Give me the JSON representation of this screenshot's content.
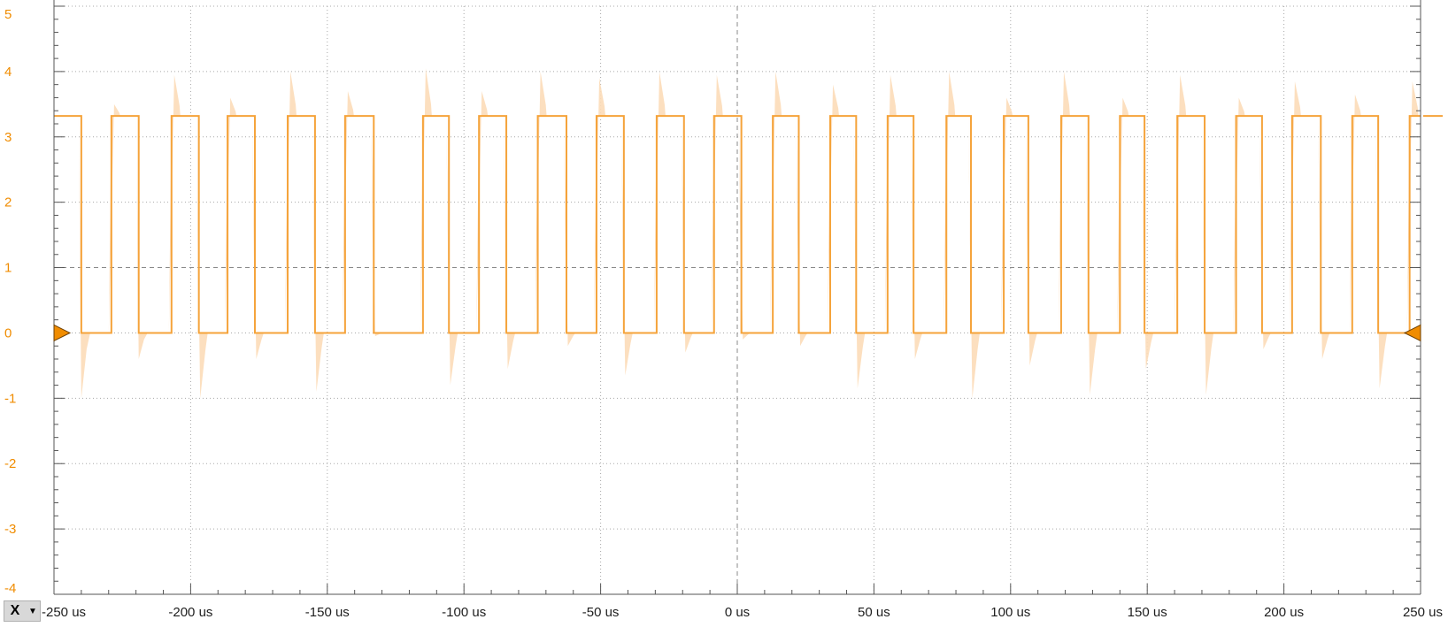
{
  "chart_data": {
    "type": "line",
    "title": "",
    "xlabel": "",
    "ylabel": "",
    "xlim": [
      -250,
      250
    ],
    "ylim": [
      -4,
      5
    ],
    "x_unit": "us",
    "x_ticks": [
      "-250 us",
      "-200 us",
      "-150 us",
      "-100 us",
      "-50 us",
      "0 us",
      "50 us",
      "100 us",
      "150 us",
      "200 us",
      "250 us"
    ],
    "x_tick_values": [
      -250,
      -200,
      -150,
      -100,
      -50,
      0,
      50,
      100,
      150,
      200,
      250
    ],
    "y_ticks": [
      "5",
      "4",
      "3",
      "2",
      "1",
      "0",
      "-1",
      "-2",
      "-3",
      "-4"
    ],
    "y_tick_values": [
      5,
      4,
      3,
      2,
      1,
      0,
      -1,
      -2,
      -3,
      -4
    ],
    "grid": true,
    "trigger_level": 1,
    "ground_level": 0,
    "colors": {
      "trace": "#f5a33a",
      "envelope": "#fcdcb8",
      "axis_label": "#f08c00",
      "grid": "#a8a8a8"
    },
    "series": [
      {
        "high_level": 3.32,
        "low_level": 0,
        "edges": [
          {
            "t": -250,
            "v": 3.32
          },
          {
            "t": -240.0,
            "v": 0
          },
          {
            "t": -229.0,
            "v": 3.32
          },
          {
            "t": -219.0,
            "v": 0
          },
          {
            "t": -207.0,
            "v": 3.32
          },
          {
            "t": -197.0,
            "v": 0
          },
          {
            "t": -186.5,
            "v": 3.32
          },
          {
            "t": -176.5,
            "v": 0
          },
          {
            "t": -164.5,
            "v": 3.32
          },
          {
            "t": -154.5,
            "v": 0
          },
          {
            "t": -143.5,
            "v": 3.32
          },
          {
            "t": -133.0,
            "v": 0
          },
          {
            "t": -115.0,
            "v": 3.32
          },
          {
            "t": -105.5,
            "v": 0
          },
          {
            "t": -94.5,
            "v": 3.32
          },
          {
            "t": -84.5,
            "v": 0
          },
          {
            "t": -73.0,
            "v": 3.32
          },
          {
            "t": -62.5,
            "v": 0
          },
          {
            "t": -51.5,
            "v": 3.32
          },
          {
            "t": -41.5,
            "v": 0
          },
          {
            "t": -29.5,
            "v": 3.32
          },
          {
            "t": -19.5,
            "v": 0
          },
          {
            "t": -8.5,
            "v": 3.32
          },
          {
            "t": 1.5,
            "v": 0
          },
          {
            "t": 13.0,
            "v": 3.32
          },
          {
            "t": 22.5,
            "v": 0
          },
          {
            "t": 34.0,
            "v": 3.32
          },
          {
            "t": 43.5,
            "v": 0
          },
          {
            "t": 55.0,
            "v": 3.32
          },
          {
            "t": 64.5,
            "v": 0
          },
          {
            "t": 76.5,
            "v": 3.32
          },
          {
            "t": 85.5,
            "v": 0
          },
          {
            "t": 97.5,
            "v": 3.32
          },
          {
            "t": 106.5,
            "v": 0
          },
          {
            "t": 118.5,
            "v": 3.32
          },
          {
            "t": 128.5,
            "v": 0
          },
          {
            "t": 140.0,
            "v": 3.32
          },
          {
            "t": 149.0,
            "v": 0
          },
          {
            "t": 161.0,
            "v": 3.32
          },
          {
            "t": 171.0,
            "v": 0
          },
          {
            "t": 182.5,
            "v": 3.32
          },
          {
            "t": 192.0,
            "v": 0
          },
          {
            "t": 203.0,
            "v": 3.32
          },
          {
            "t": 213.5,
            "v": 0
          },
          {
            "t": 225.0,
            "v": 3.32
          },
          {
            "t": 234.5,
            "v": 0
          },
          {
            "t": 246.0,
            "v": 3.32
          },
          {
            "t": 250,
            "v": 3.32
          }
        ]
      }
    ],
    "envelope_peaks": [
      {
        "t": -249.0,
        "v": 3.9
      },
      {
        "t": -240.0,
        "v": -1.0
      },
      {
        "t": -228.0,
        "v": 3.5
      },
      {
        "t": -219.0,
        "v": -0.4
      },
      {
        "t": -206.0,
        "v": 3.95
      },
      {
        "t": -196.5,
        "v": -1.0
      },
      {
        "t": -185.5,
        "v": 3.6
      },
      {
        "t": -176.0,
        "v": -0.4
      },
      {
        "t": -163.5,
        "v": 4.0
      },
      {
        "t": -154.0,
        "v": -0.9
      },
      {
        "t": -142.5,
        "v": 3.7
      },
      {
        "t": -132.5,
        "v": -0.05
      },
      {
        "t": -114.0,
        "v": 4.05
      },
      {
        "t": -105.0,
        "v": -0.8
      },
      {
        "t": -93.5,
        "v": 3.7
      },
      {
        "t": -84.0,
        "v": -0.55
      },
      {
        "t": -72.0,
        "v": 4.0
      },
      {
        "t": -62.0,
        "v": -0.2
      },
      {
        "t": -50.5,
        "v": 3.9
      },
      {
        "t": -41.0,
        "v": -0.65
      },
      {
        "t": -28.5,
        "v": 4.0
      },
      {
        "t": -19.0,
        "v": -0.3
      },
      {
        "t": -7.5,
        "v": 3.95
      },
      {
        "t": 2.0,
        "v": -0.1
      },
      {
        "t": 14.0,
        "v": 4.0
      },
      {
        "t": 23.0,
        "v": -0.2
      },
      {
        "t": 35.0,
        "v": 3.8
      },
      {
        "t": 44.0,
        "v": -0.85
      },
      {
        "t": 56.0,
        "v": 3.95
      },
      {
        "t": 65.0,
        "v": -0.4
      },
      {
        "t": 77.5,
        "v": 4.0
      },
      {
        "t": 86.0,
        "v": -1.0
      },
      {
        "t": 98.5,
        "v": 3.6
      },
      {
        "t": 107.0,
        "v": -0.5
      },
      {
        "t": 119.5,
        "v": 4.0
      },
      {
        "t": 129.0,
        "v": -0.95
      },
      {
        "t": 141.0,
        "v": 3.6
      },
      {
        "t": 149.5,
        "v": -0.55
      },
      {
        "t": 162.0,
        "v": 3.95
      },
      {
        "t": 171.5,
        "v": -0.95
      },
      {
        "t": 183.5,
        "v": 3.6
      },
      {
        "t": 192.5,
        "v": -0.25
      },
      {
        "t": 204.0,
        "v": 3.85
      },
      {
        "t": 214.0,
        "v": -0.4
      },
      {
        "t": 226.0,
        "v": 3.65
      },
      {
        "t": 235.0,
        "v": -0.85
      },
      {
        "t": 247.0,
        "v": 3.85
      }
    ]
  },
  "controls": {
    "x_button": "X",
    "dropdown_icon": "triangle-down-icon"
  }
}
